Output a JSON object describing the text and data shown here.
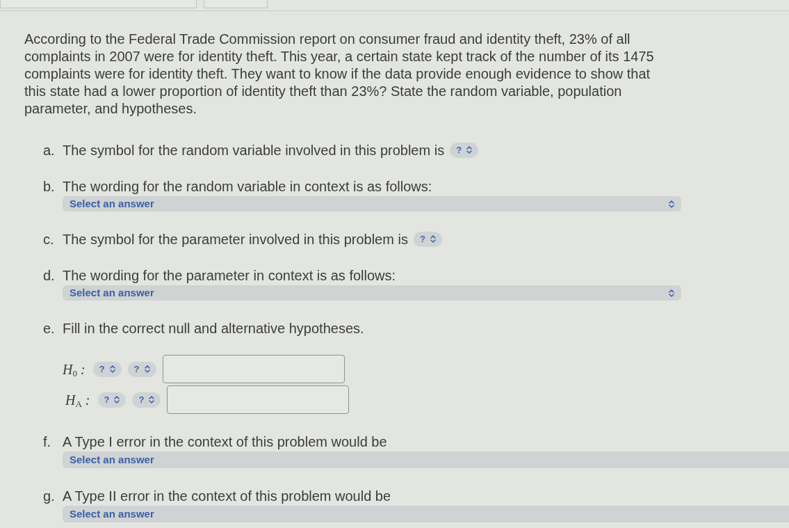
{
  "top_bar": {
    "buttons": [
      {
        "kind": "blank"
      },
      {
        "kind": "blank"
      }
    ]
  },
  "question": "According to the Federal Trade Commission report on consumer fraud and identity theft, 23% of all complaints in 2007 were for identity theft. This year, a certain state kept track of the number of its 1475 complaints were for identity theft. They want to know if the data provide enough evidence to show that this state had a lower proportion of identity theft than 23%? State the random variable, population parameter, and hypotheses.",
  "parts": [
    {
      "kind": "inline_select",
      "letter": "a.",
      "text": "The symbol for the random variable involved in this problem is",
      "select": "?"
    },
    {
      "kind": "dropdown",
      "letter": "b.",
      "text": "The wording for the random variable in context is as follows:",
      "select": "Select an answer"
    },
    {
      "kind": "inline_select",
      "letter": "c.",
      "text": "The symbol for the parameter involved in this problem is",
      "select": "?"
    },
    {
      "kind": "dropdown",
      "letter": "d.",
      "text": "The wording for the parameter in context is as follows:",
      "select": "Select an answer"
    },
    {
      "kind": "hypotheses",
      "letter": "e.",
      "text": "Fill in the correct null and alternative hypotheses.",
      "rows": [
        {
          "label": "H$_{0}$ :",
          "selects": [
            "?",
            "?"
          ]
        },
        {
          "label": "H$_{A}$ :",
          "selects": [
            "?",
            "?"
          ]
        }
      ]
    },
    {
      "kind": "dropdown_cut",
      "letter": "f.",
      "text": "A Type I error in the context of this problem would be",
      "select": "Select an answer"
    },
    {
      "kind": "dropdown_cut",
      "letter": "g.",
      "text": "A Type II error in the context of this problem would be",
      "select": "Select an answer"
    }
  ]
}
